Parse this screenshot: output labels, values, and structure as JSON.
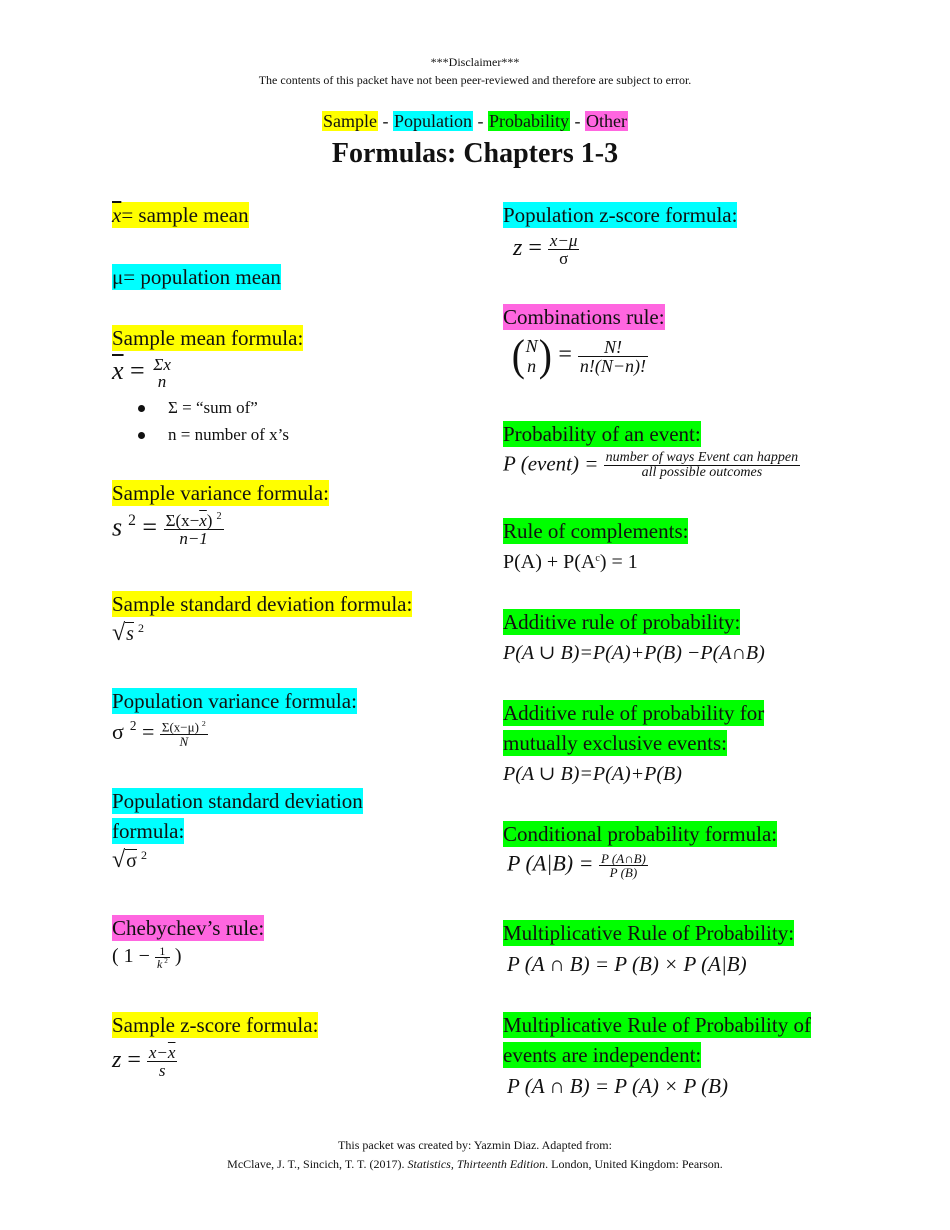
{
  "header": {
    "disclaimer_title": "***Disclaimer***",
    "disclaimer_text": "The contents of this packet have not been peer-reviewed and therefore are subject to error.",
    "legend": [
      {
        "label": "Sample",
        "color": "#ffff00"
      },
      {
        "label": "Population",
        "color": "#00ffff"
      },
      {
        "label": "Probability",
        "color": "#00ff00"
      },
      {
        "label": "Other",
        "color": "#ff66e0"
      }
    ],
    "legend_separator": "-",
    "title": "Formulas: Chapters 1-3"
  },
  "left": {
    "xbar_def": {
      "symbol": "x",
      "text": "= sample mean"
    },
    "mu_def": {
      "symbol": "μ",
      "text": "= population mean"
    },
    "sample_mean": {
      "label": "Sample mean formula:",
      "lhs": "x",
      "eq": "=",
      "num": "Σx",
      "den": "n",
      "bullets": [
        "Σ = “sum of”",
        "n = number of x’s"
      ]
    },
    "sample_variance": {
      "label": "Sample variance formula:",
      "lhs": "s",
      "exp": "2",
      "eq": "=",
      "num_pre": "Σ(x−",
      "num_bar": "x",
      "num_post": ")",
      "num_exp": "2",
      "den": "n−1"
    },
    "sample_sd": {
      "label": "Sample standard deviation formula:",
      "radicand": "s",
      "exp": "2"
    },
    "population_variance": {
      "label": "Population variance formula:",
      "lhs": "σ",
      "exp": "2",
      "eq": "=",
      "num": "Σ(x−μ)",
      "num_exp": "2",
      "den": "N"
    },
    "population_sd": {
      "label_line1": "Population standard deviation",
      "label_line2": "formula:",
      "radicand": "σ",
      "exp": "2"
    },
    "chebychev": {
      "label": "Chebychev’s rule:",
      "open": "( 1 −",
      "num": "1",
      "den": "k",
      "den_exp": "2",
      "close": ")"
    },
    "sample_z": {
      "label": "Sample z-score formula:",
      "lhs": "z",
      "eq": "=",
      "num_pre": "x−",
      "num_bar": "x",
      "den": "s"
    }
  },
  "right": {
    "population_z": {
      "label": "Population z-score formula:",
      "lhs": "z",
      "eq": "=",
      "num": "x−μ",
      "den": "σ"
    },
    "combinations": {
      "label": "Combinations rule:",
      "top": "N",
      "bottom": "n",
      "eq": "=",
      "num": "N!",
      "den": "n!(N−n)!"
    },
    "prob_event": {
      "label": "Probability of an event:",
      "lhs": "P (event) =",
      "num": "number of ways Event can happen",
      "den": "all possible outcomes"
    },
    "complements": {
      "label": "Rule of complements:",
      "formula_pre": "P(A) + P(A",
      "formula_sup": "c",
      "formula_post": ") = 1"
    },
    "additive": {
      "label": "Additive rule of probability:",
      "formula": "P(A ∪ B)=P(A)+P(B) −P(A∩B)"
    },
    "additive_exclusive": {
      "label_line1": "Additive rule of probability for",
      "label_line2": "mutually exclusive events:",
      "formula": "P(A ∪ B)=P(A)+P(B)"
    },
    "conditional": {
      "label": "Conditional probability formula:",
      "lhs": "P (A|B) =",
      "num": "P (A∩B)",
      "den": "P (B)"
    },
    "multiplicative": {
      "label": "Multiplicative Rule of Probability:",
      "formula": "P (A ∩ B) = P (B) × P (A|B)"
    },
    "multiplicative_independent": {
      "label_line1": "Multiplicative Rule of Probability of",
      "label_line2": "events are independent:",
      "formula": "P (A ∩ B) = P (A) × P (B)"
    }
  },
  "footer": {
    "line1": "This packet was created by: Yazmin Diaz. Adapted from:",
    "line2_pre": "McClave, J. T., Sincich, T. T. (2017). ",
    "line2_italic": "Statistics, Thirteenth Edition",
    "line2_post": ". London, United Kingdom: Pearson."
  }
}
